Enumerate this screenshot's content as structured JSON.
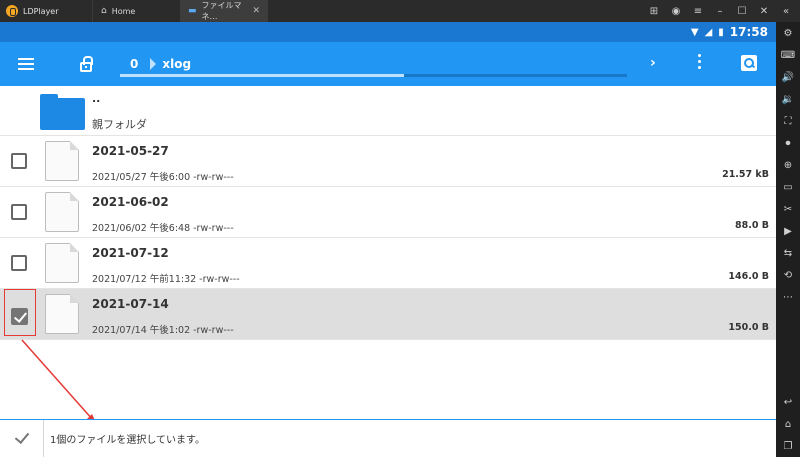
{
  "window": {
    "app_name": "LDPlayer",
    "tabs": [
      {
        "label": "Home",
        "icon": "home-icon"
      },
      {
        "label": "ファイルマネ…",
        "icon": "folder-icon"
      }
    ]
  },
  "statusbar": {
    "time": "17:58"
  },
  "appbar": {
    "count": "0",
    "folder": "xlog",
    "progress": 0.56
  },
  "parent_row": {
    "dots": "..",
    "label": "親フォルダ"
  },
  "files": [
    {
      "name": "2021-05-27",
      "meta": "2021/05/27 午後6:00  -rw-rw---",
      "size": "21.57 kB",
      "checked": false
    },
    {
      "name": "2021-06-02",
      "meta": "2021/06/02 午後6:48  -rw-rw---",
      "size": "88.0 B",
      "checked": false
    },
    {
      "name": "2021-07-12",
      "meta": "2021/07/12 午前11:32  -rw-rw---",
      "size": "146.0 B",
      "checked": false
    },
    {
      "name": "2021-07-14",
      "meta": "2021/07/14 午後1:02  -rw-rw---",
      "size": "150.0 B",
      "checked": true
    }
  ],
  "bottombar": {
    "status": "1個のファイルを選択しています。"
  },
  "colors": {
    "statusbar": "#1a78d2",
    "appbar": "#2196f3",
    "annotation": "#e53935"
  }
}
